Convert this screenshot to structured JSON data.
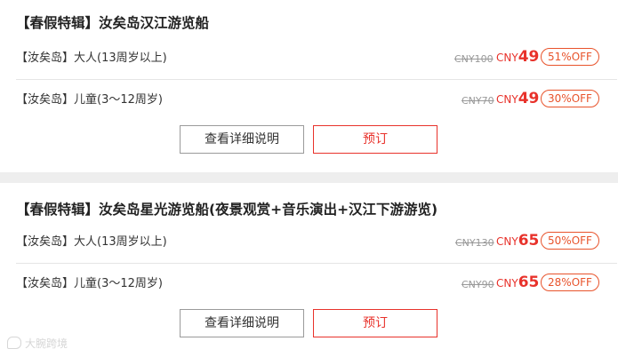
{
  "products": [
    {
      "title": "【春假特辑】汝矣岛汉江游览船",
      "rows": [
        {
          "label": "【汝矣岛】大人(13周岁以上)",
          "orig_price": "CNY100",
          "currency": "CNY",
          "price": "49",
          "discount": "51%OFF"
        },
        {
          "label": "【汝矣岛】儿童(3～12周岁)",
          "orig_price": "CNY70",
          "currency": "CNY",
          "price": "49",
          "discount": "30%OFF"
        }
      ],
      "detail_button": "查看详细说明",
      "book_button": "预订"
    },
    {
      "title": "【春假特辑】汝矣岛星光游览船(夜景观赏+音乐演出+汉江下游游览)",
      "rows": [
        {
          "label": "【汝矣岛】大人(13周岁以上)",
          "orig_price": "CNY130",
          "currency": "CNY",
          "price": "65",
          "discount": "50%OFF"
        },
        {
          "label": "【汝矣岛】儿童(3～12周岁)",
          "orig_price": "CNY90",
          "currency": "CNY",
          "price": "65",
          "discount": "28%OFF"
        }
      ],
      "detail_button": "查看详细说明",
      "book_button": "预订"
    }
  ],
  "watermark": "大腕跨境",
  "colors": {
    "accent": "#e8322b",
    "badge": "#e8532b",
    "separator": "#eeeeee"
  }
}
